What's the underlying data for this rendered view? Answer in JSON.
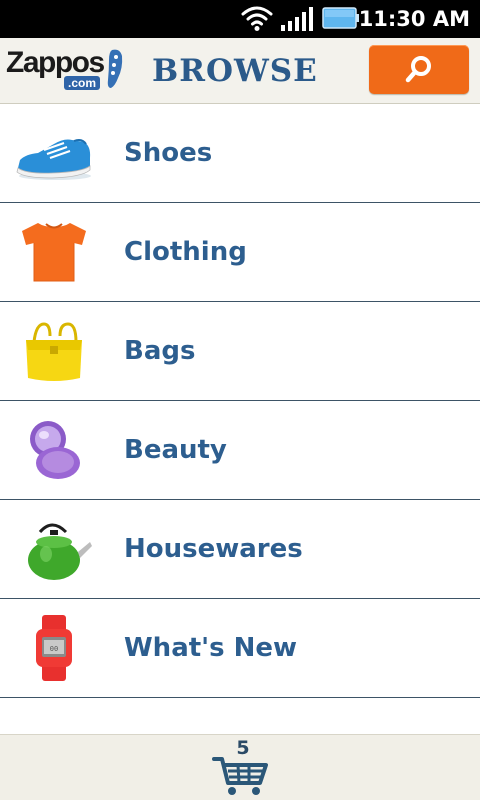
{
  "status_bar": {
    "time": "11:30 AM",
    "icons": [
      "wifi-icon",
      "signal-icon",
      "battery-icon"
    ]
  },
  "header": {
    "logo_text": "Zappos",
    "logo_domain": ".com",
    "title": "BROWSE",
    "search_icon": "search-icon"
  },
  "categories": [
    {
      "label": "Shoes",
      "icon": "sneaker-icon"
    },
    {
      "label": "Clothing",
      "icon": "tshirt-icon"
    },
    {
      "label": "Bags",
      "icon": "handbag-icon"
    },
    {
      "label": "Beauty",
      "icon": "compact-icon"
    },
    {
      "label": "Housewares",
      "icon": "kettle-icon"
    },
    {
      "label": "What's New",
      "icon": "watch-icon"
    }
  ],
  "footer": {
    "cart_count": "5",
    "cart_icon": "shopping-cart-icon"
  },
  "colors": {
    "accent": "#f06a18",
    "brand_blue": "#2d5e8f",
    "header_bg": "#f3f2ec"
  }
}
